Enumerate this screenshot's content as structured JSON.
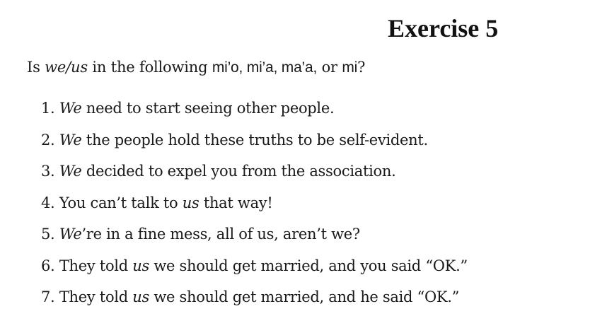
{
  "title": "Exercise 5",
  "prompt": {
    "lead": "Is ",
    "pronoun": "we/us",
    "middle": " in the following ",
    "options": "mi’o, mi’a, ma’a,",
    "or_text": " or ",
    "last_option": "mi",
    "end": "?"
  },
  "items": [
    {
      "num": "1. ",
      "pre": "",
      "em": "We",
      "post": " need to start seeing other people."
    },
    {
      "num": "2. ",
      "pre": "",
      "em": "We",
      "post": " the people hold these truths to be self-evident."
    },
    {
      "num": "3. ",
      "pre": "",
      "em": "We",
      "post": " decided to expel you from the association."
    },
    {
      "num": "4. ",
      "pre": "You can’t talk to ",
      "em": "us",
      "post": " that way!"
    },
    {
      "num": "5. ",
      "pre": "",
      "em": "We",
      "post": "’re in a fine mess, all of us, aren’t we?"
    },
    {
      "num": "6. ",
      "pre": "They told ",
      "em": "us",
      "post": " we should get married, and you said “OK.”"
    },
    {
      "num": "7. ",
      "pre": "They told ",
      "em": "us",
      "post": " we should get married, and he said “OK.”"
    }
  ]
}
